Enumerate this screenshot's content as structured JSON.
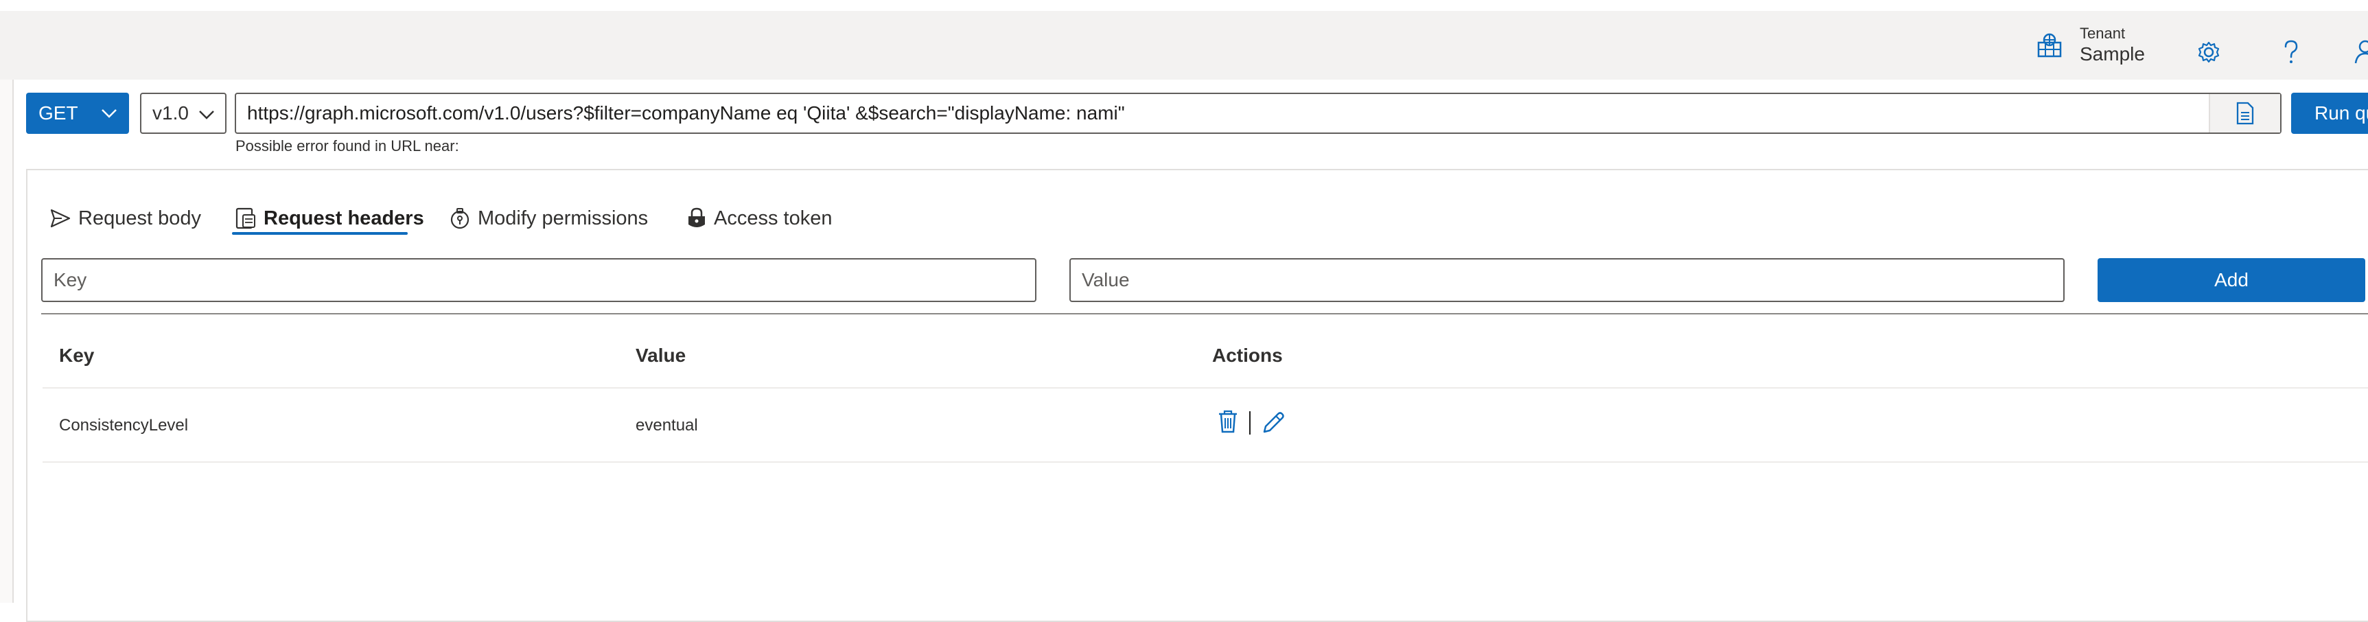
{
  "header": {
    "tenant_label": "Tenant",
    "tenant_value": "Sample",
    "icons": [
      "globe-icon",
      "settings-icon",
      "help-icon",
      "account-icon"
    ]
  },
  "query": {
    "method": "GET",
    "version": "v1.0",
    "url": "https://graph.microsoft.com/v1.0/users?$filter=companyName eq 'Qiita' &$search=\"displayName: nami\"",
    "run_label": "Run qu",
    "error_text": "Possible error found in URL near:"
  },
  "tabs": [
    {
      "label": "Request body",
      "icon": "send-icon",
      "active": false
    },
    {
      "label": "Request headers",
      "icon": "headers-icon",
      "active": true
    },
    {
      "label": "Modify permissions",
      "icon": "permissions-icon",
      "active": false
    },
    {
      "label": "Access token",
      "icon": "lock-icon",
      "active": false
    }
  ],
  "header_form": {
    "key_placeholder": "Key",
    "value_placeholder": "Value",
    "add_label": "Add"
  },
  "headers_table": {
    "columns": [
      "Key",
      "Value",
      "Actions"
    ],
    "rows": [
      {
        "key": "ConsistencyLevel",
        "value": "eventual",
        "actions": [
          "delete-icon",
          "edit-icon"
        ]
      }
    ]
  },
  "colors": {
    "accent": "#0f6cbd",
    "header_bg": "#f3f2f1",
    "border": "#605e5c",
    "text": "#323130"
  }
}
